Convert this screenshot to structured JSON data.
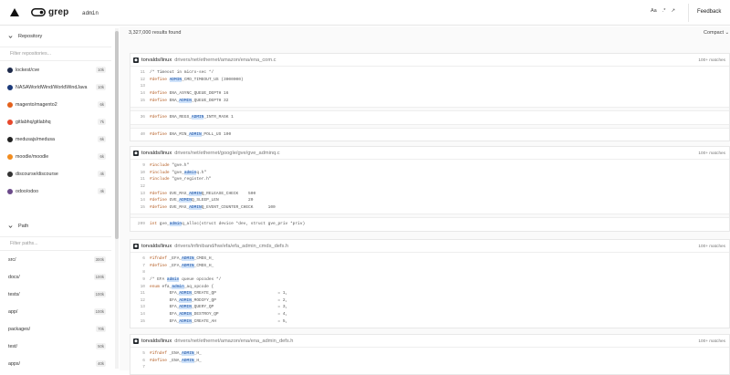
{
  "search": {
    "query": "admin",
    "options": [
      "Aa",
      ".*",
      "↗"
    ],
    "feedback_label": "Feedback"
  },
  "sidebar": {
    "repository_label": "Repository",
    "filter_repos_placeholder": "Filter repositories...",
    "repos": [
      {
        "name": "lockest/cve",
        "count": "10k",
        "color": "#1e2a4a"
      },
      {
        "name": "NASAWorldWind/WorldWindJava",
        "count": "10k",
        "color": "#1b3a7a"
      },
      {
        "name": "magento/magento2",
        "count": "6k",
        "color": "#e3611c"
      },
      {
        "name": "gitlabhq/gitlabhq",
        "count": "7k",
        "color": "#e8482c"
      },
      {
        "name": "medusajs/medusa",
        "count": "6k",
        "color": "#222222"
      },
      {
        "name": "moodle/moodle",
        "count": "6k",
        "color": "#f28c1e"
      },
      {
        "name": "discourse/discourse",
        "count": "4k",
        "color": "#333333"
      },
      {
        "name": "odoo/odoo",
        "count": "4k",
        "color": "#6b4a8a"
      }
    ],
    "path_label": "Path",
    "filter_paths_placeholder": "Filter paths...",
    "paths": [
      {
        "name": "src/",
        "count": "300k"
      },
      {
        "name": "docs/",
        "count": "100k"
      },
      {
        "name": "tests/",
        "count": "100k"
      },
      {
        "name": "app/",
        "count": "100k"
      },
      {
        "name": "packages/",
        "count": "70k"
      },
      {
        "name": "test/",
        "count": "50k"
      },
      {
        "name": "apps/",
        "count": "40k"
      }
    ]
  },
  "results": {
    "count_label": "3,327,000 results found",
    "compact_label": "Compact",
    "cards": [
      {
        "repo": "torvalds/linux",
        "path": "drivers/net/ethernet/amazon/ena/ena_com.c",
        "matches": "100+ matches",
        "blocks": [
          [
            [
              "11",
              "/* Timeout in micro-sec */"
            ],
            [
              "12",
              "#define ADMIN_CMD_TIMEOUT_US (3000000)"
            ],
            [
              "13",
              ""
            ],
            [
              "14",
              "#define ENA_ASYNC_QUEUE_DEPTH 16"
            ],
            [
              "15",
              "#define ENA_ADMIN_QUEUE_DEPTH 32"
            ]
          ],
          [
            [
              "36",
              "#define ENA_REGS_ADMIN_INTR_MASK 1"
            ]
          ],
          [
            [
              "40",
              "#define ENA_MIN_ADMIN_POLL_US 100"
            ]
          ]
        ]
      },
      {
        "repo": "torvalds/linux",
        "path": "drivers/net/ethernet/google/gve/gve_adminq.c",
        "matches": "100+ matches",
        "blocks": [
          [
            [
              "9",
              "#include \"gve.h\""
            ],
            [
              "10",
              "#include \"gve_adminq.h\""
            ],
            [
              "11",
              "#include \"gve_register.h\""
            ],
            [
              "12",
              ""
            ],
            [
              "13",
              "#define GVE_MAX_ADMINQ_RELEASE_CHECK    500"
            ],
            [
              "14",
              "#define GVE_ADMINQ_SLEEP_LEN            20"
            ],
            [
              "15",
              "#define GVE_MAX_ADMINQ_EVENT_COUNTER_CHECK      100"
            ]
          ],
          [
            [
              "209",
              "int gve_adminq_alloc(struct device *dev, struct gve_priv *priv)"
            ]
          ]
        ]
      },
      {
        "repo": "torvalds/linux",
        "path": "drivers/infiniband/hw/efa/efa_admin_cmds_defs.h",
        "matches": "100+ matches",
        "blocks": [
          [
            [
              "6",
              "#ifndef _EFA_ADMIN_CMDS_H_"
            ],
            [
              "7",
              "#define _EFA_ADMIN_CMDS_H_"
            ],
            [
              "8",
              ""
            ],
            [
              "9",
              "/* EFA admin queue opcodes */"
            ],
            [
              "10",
              "enum efa_admin_aq_opcode {"
            ],
            [
              "11",
              "        EFA_ADMIN_CREATE_QP                         = 1,"
            ],
            [
              "12",
              "        EFA_ADMIN_MODIFY_QP                         = 2,"
            ],
            [
              "13",
              "        EFA_ADMIN_QUERY_QP                          = 3,"
            ],
            [
              "14",
              "        EFA_ADMIN_DESTROY_QP                        = 4,"
            ],
            [
              "15",
              "        EFA_ADMIN_CREATE_AH                         = 5,"
            ]
          ]
        ]
      },
      {
        "repo": "torvalds/linux",
        "path": "drivers/net/ethernet/amazon/ena/ena_admin_defs.h",
        "matches": "100+ matches",
        "blocks": [
          [
            [
              "5",
              "#ifndef _ENA_ADMIN_H_"
            ],
            [
              "6",
              "#define _ENA_ADMIN_H_"
            ],
            [
              "7",
              ""
            ]
          ]
        ]
      }
    ]
  }
}
